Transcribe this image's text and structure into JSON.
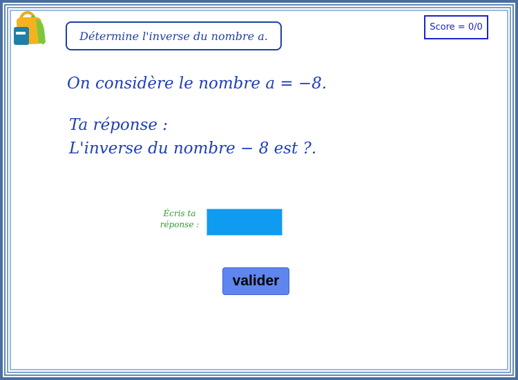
{
  "header": {
    "instruction": "Détermine l'inverse du nombre a.",
    "score": "Score = 0/0"
  },
  "main": {
    "statement": "On considère le nombre a = −8.",
    "answer_title": "Ta réponse :",
    "question": "L'inverse du nombre  − 8 est ?."
  },
  "form": {
    "input_label_line1": "Écris ta",
    "input_label_line2": "réponse :",
    "input_value": "",
    "submit_label": "valider"
  },
  "colors": {
    "accent": "#1f3fb8",
    "input_bg": "#0f9bf0",
    "button_bg": "#5f86ee",
    "label_green": "#2e9a2e"
  },
  "icons": {
    "logo": "backpack-icon"
  }
}
